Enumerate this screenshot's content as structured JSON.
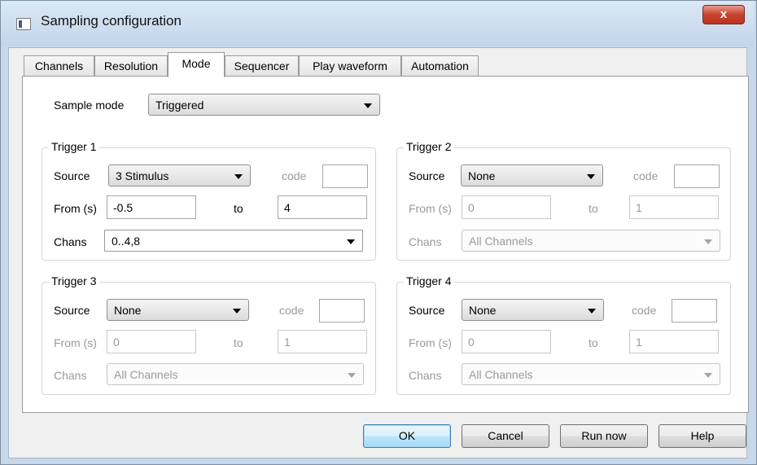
{
  "window": {
    "title": "Sampling configuration",
    "close_glyph": "x"
  },
  "tabs": [
    {
      "label": "Channels"
    },
    {
      "label": "Resolution"
    },
    {
      "label": "Mode"
    },
    {
      "label": "Sequencer"
    },
    {
      "label": "Play waveform"
    },
    {
      "label": "Automation"
    }
  ],
  "active_tab": "Mode",
  "sample_mode": {
    "label": "Sample mode",
    "value": "Triggered"
  },
  "triggers": [
    {
      "title": "Trigger 1",
      "source_label": "Source",
      "source": "3 Stimulus",
      "code_label": "code",
      "code": "",
      "from_label": "From (s)",
      "from": "-0.5",
      "to_label": "to",
      "to": "4",
      "chans_label": "Chans",
      "chans": "0..4,8"
    },
    {
      "title": "Trigger 2",
      "source_label": "Source",
      "source": "None",
      "code_label": "code",
      "code": "",
      "from_label": "From (s)",
      "from": "0",
      "to_label": "to",
      "to": "1",
      "chans_label": "Chans",
      "chans": "All Channels"
    },
    {
      "title": "Trigger 3",
      "source_label": "Source",
      "source": "None",
      "code_label": "code",
      "code": "",
      "from_label": "From (s)",
      "from": "0",
      "to_label": "to",
      "to": "1",
      "chans_label": "Chans",
      "chans": "All Channels"
    },
    {
      "title": "Trigger 4",
      "source_label": "Source",
      "source": "None",
      "code_label": "code",
      "code": "",
      "from_label": "From (s)",
      "from": "0",
      "to_label": "to",
      "to": "1",
      "chans_label": "Chans",
      "chans": "All Channels"
    }
  ],
  "buttons": {
    "ok": "OK",
    "cancel": "Cancel",
    "run_now": "Run now",
    "help": "Help"
  },
  "colors": {
    "title_bar": "#c7d8ea",
    "close_button": "#c9442f",
    "default_button": "#bee6fd",
    "disabled_text": "#9a9a9a"
  }
}
